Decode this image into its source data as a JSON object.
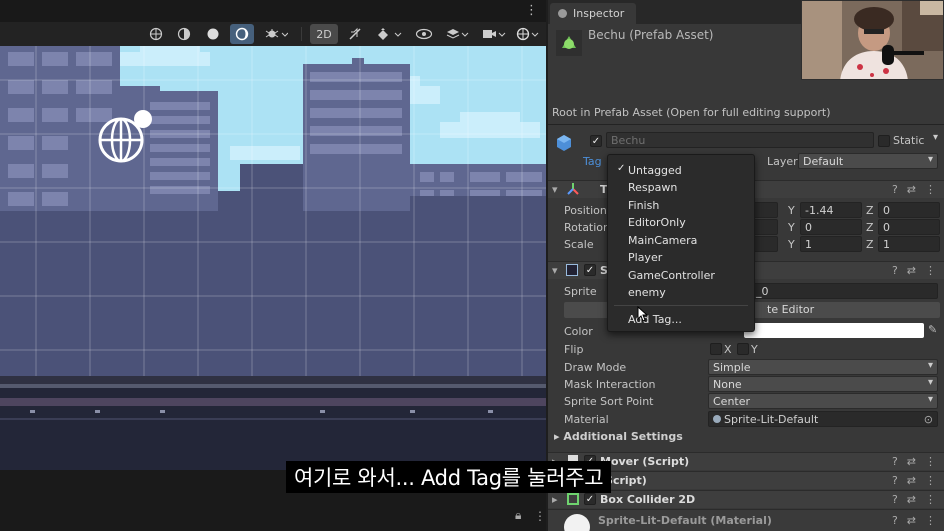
{
  "scene_view": {
    "menu_icon": "kebab-menu-icon",
    "toolbar": {
      "mode_2d_label": "2D",
      "buttons": [
        "gizmo-globe-icon",
        "shading-icon",
        "sphere-icon",
        "moon-icon",
        "bug-icon",
        "2d-toggle",
        "audio-icon",
        "effects-icon",
        "visibility-icon",
        "layers-icon",
        "camera-icon",
        "gizmos-icon"
      ]
    },
    "bottom": {
      "lock_icon": "lock-icon"
    }
  },
  "inspector": {
    "tab_label": "Inspector",
    "asset_title": "Bechu (Prefab Asset)",
    "root_note": "Root in Prefab Asset (Open for full editing support)",
    "gameobject": {
      "name": "Bechu",
      "active": true,
      "static_label": "Static",
      "tag_label": "Tag",
      "layer_label": "Layer",
      "layer_value": "Default"
    },
    "transform": {
      "title": "T",
      "position_label": "Position",
      "rotation_label": "Rotation",
      "scale_label": "Scale",
      "position": {
        "y": "-1.44",
        "z": "0"
      },
      "rotation": {
        "y": "0",
        "z": "0"
      },
      "scale": {
        "y": "1",
        "z": "1"
      }
    },
    "sprite_renderer": {
      "title": "S",
      "sprite_label": "Sprite",
      "sprite_value": "u_0",
      "open_editor_label": "te Editor",
      "color_label": "Color",
      "color_value": "#ffffff",
      "flip_label": "Flip",
      "flip_x": "X",
      "flip_y": "Y",
      "draw_mode_label": "Draw Mode",
      "draw_mode_value": "Simple",
      "mask_label": "Mask Interaction",
      "mask_value": "None",
      "sort_point_label": "Sprite Sort Point",
      "sort_point_value": "Center",
      "material_label": "Material",
      "material_value": "Sprite-Lit-Default",
      "additional_label": "Additional Settings"
    },
    "mover_script": {
      "title": "Mover (Script)"
    },
    "script2": {
      "title": "(Script)"
    },
    "box_collider": {
      "title": "Box Collider 2D"
    },
    "material_footer": "Sprite-Lit-Default (Material)"
  },
  "tag_dropdown": {
    "selected": "Untagged",
    "items": [
      "Untagged",
      "Respawn",
      "Finish",
      "EditorOnly",
      "MainCamera",
      "Player",
      "GameController",
      "enemy"
    ],
    "add_label": "Add Tag..."
  },
  "subtitle": "여기로 와서... Add Tag를 눌러주고",
  "colors": {
    "sky": "#ace2f4",
    "building": "#4b5278",
    "window": "#737aa2",
    "ground": "#232638",
    "accent_blue": "#4d8fd8"
  }
}
